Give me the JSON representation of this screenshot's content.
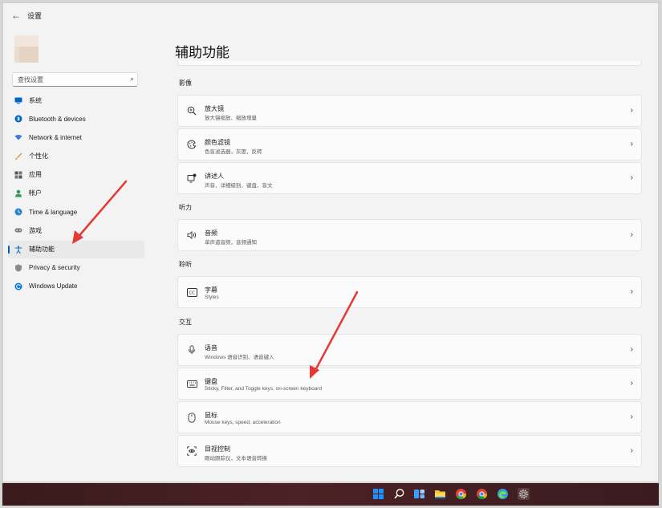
{
  "window": {
    "title": "设置",
    "back_glyph": "←"
  },
  "search": {
    "placeholder": "查找设置"
  },
  "nav": {
    "items": [
      {
        "label": "系统",
        "icon": "monitor-icon",
        "color": "#0067c0"
      },
      {
        "label": "Bluetooth & devices",
        "icon": "bluetooth-icon",
        "color": "#0067c0"
      },
      {
        "label": "Network & internet",
        "icon": "wifi-icon",
        "color": "#3a7bd5"
      },
      {
        "label": "个性化",
        "icon": "brush-icon",
        "color": "#c8842a"
      },
      {
        "label": "应用",
        "icon": "apps-icon",
        "color": "#555555"
      },
      {
        "label": "帐户",
        "icon": "person-icon",
        "color": "#2b9b5a"
      },
      {
        "label": "Time & language",
        "icon": "globe-clock-icon",
        "color": "#2a86c8"
      },
      {
        "label": "游戏",
        "icon": "gamepad-icon",
        "color": "#7a7a7a"
      },
      {
        "label": "辅助功能",
        "icon": "accessibility-icon",
        "color": "#1a6fc4",
        "active": true
      },
      {
        "label": "Privacy & security",
        "icon": "shield-icon",
        "color": "#7a7a7a"
      },
      {
        "label": "Windows Update",
        "icon": "update-icon",
        "color": "#0a78d4"
      }
    ]
  },
  "main": {
    "title": "辅助功能",
    "sections": [
      {
        "label": "影像",
        "cards": [
          {
            "title": "放大镜",
            "sub": "放大镜缩放、缩放增量",
            "icon": "magnifier-icon"
          },
          {
            "title": "颜色滤镜",
            "sub": "色盲滤选器，灰度，反转",
            "icon": "color-filter-icon"
          },
          {
            "title": "讲述人",
            "sub": "声音、详细级别、键盘、盲文",
            "icon": "narrator-icon"
          }
        ]
      },
      {
        "label": "听力",
        "cards": [
          {
            "title": "音频",
            "sub": "单声道音频，音频通知",
            "icon": "speaker-icon"
          }
        ]
      },
      {
        "label": "聆听",
        "cards": [
          {
            "title": "字幕",
            "sub": "Styles",
            "icon": "captions-icon"
          }
        ]
      },
      {
        "label": "交互",
        "cards": [
          {
            "title": "语音",
            "sub": "Windows 语音识别、语音键入",
            "icon": "microphone-icon"
          },
          {
            "title": "键盘",
            "sub": "Sticky, Filter, and Toggle keys, on-screen keyboard",
            "icon": "keyboard-icon"
          },
          {
            "title": "鼠标",
            "sub": "Mouse keys, speed, acceleration",
            "icon": "mouse-icon"
          },
          {
            "title": "目视控制",
            "sub": "眼动跟踪仪，文本语音转换",
            "icon": "eye-control-icon"
          }
        ]
      }
    ],
    "chevron": "›"
  },
  "taskbar": {
    "icons": [
      {
        "name": "start-icon",
        "color": "#1e90ff"
      },
      {
        "name": "search-icon",
        "color": "#ffffff"
      },
      {
        "name": "task-view-icon",
        "color": "#3aa0ff"
      },
      {
        "name": "file-explorer-icon",
        "color": "#f4c430"
      },
      {
        "name": "chrome-icon",
        "color": "#e94235"
      },
      {
        "name": "chrome-icon-2",
        "color": "#34a853"
      },
      {
        "name": "edge-icon",
        "color": "#2fa3d8"
      },
      {
        "name": "settings-icon",
        "color": "#a0a0a0"
      }
    ]
  },
  "colors": {
    "accent": "#005fb8",
    "annotation_arrow": "#e53935"
  }
}
